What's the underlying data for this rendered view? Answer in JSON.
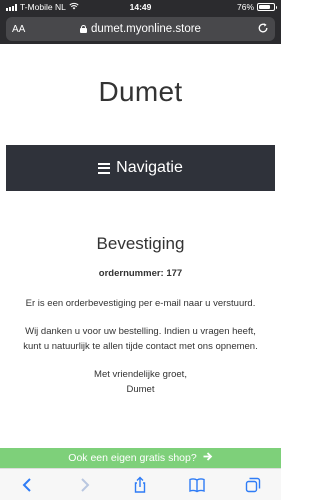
{
  "status": {
    "carrier": "T-Mobile NL",
    "time": "14:49",
    "battery": "76%",
    "battery_level": 0.76
  },
  "browser": {
    "text_size_label": "AA",
    "url": "dumet.myonline.store"
  },
  "site": {
    "title": "Dumet",
    "nav_label": "Navigatie"
  },
  "confirmation": {
    "heading": "Bevestiging",
    "order_number": "ordernummer: 177",
    "email_notice": "Er is een orderbevestiging per e-mail naar u verstuurd.",
    "thanks": "Wij danken u voor uw bestelling. Indien u vragen heeft, kunt u natuurlijk te allen tijde contact met ons opnemen.",
    "greeting": "Met vriendelijke groet,",
    "signature": "Dumet"
  },
  "promo": {
    "label": "Ook een eigen gratis shop?"
  },
  "colors": {
    "nav_bg": "#2f323a",
    "promo_bg": "#7ed07a",
    "toolbar_accent": "#2f7cf6"
  }
}
